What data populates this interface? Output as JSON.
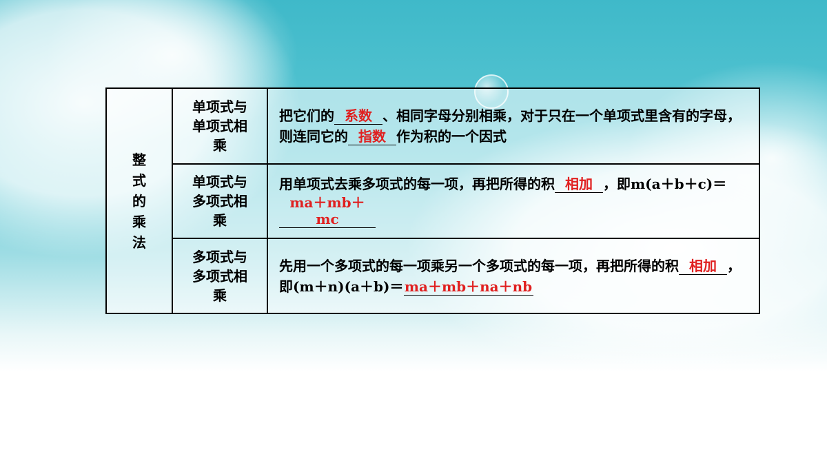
{
  "table": {
    "category": [
      "整",
      "式",
      "的",
      "乘",
      "法"
    ],
    "row1": {
      "name": [
        "单项式与",
        "单项式相",
        "乘"
      ],
      "text_a": "把它们的",
      "blank_1": "系数",
      "text_b": "、相同字母分别相乘，对于只在一个单项式里含有的字母，则连同它的",
      "blank_2": "指数",
      "text_c": "作为积的一个因式"
    },
    "row2": {
      "name": [
        "单项式与",
        "多项式相",
        "乘"
      ],
      "text_a": "用单项式去乘多项式的每一项，再把所得的积",
      "blank_1": "相加",
      "text_b": "，即m(a＋b＋c)＝",
      "blank_2": "ma＋mb＋mc"
    },
    "row3": {
      "name": [
        "多项式与",
        "多项式相",
        "乘"
      ],
      "text_a": "先用一个多项式的每一项乘另一个多项式的每一项，再把所得的积",
      "blank_1": "相加",
      "text_b": "，",
      "text_c": "即(m＋n)(a＋b)＝",
      "blank_2": "ma＋mb＋na＋nb"
    }
  },
  "colors": {
    "answer": "#e02020",
    "sky": "#3fb9c9"
  }
}
